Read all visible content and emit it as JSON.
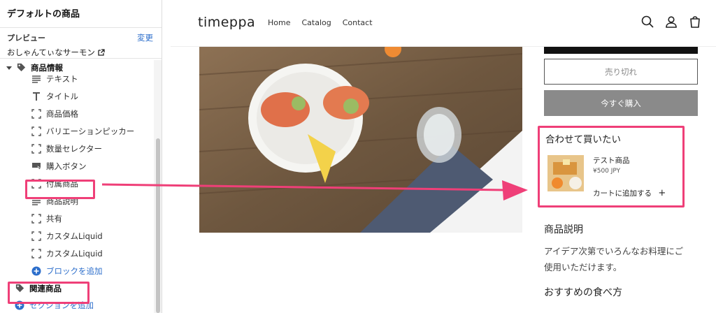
{
  "editor": {
    "section_title": "デフォルトの商品",
    "preview_label": "プレビュー",
    "preview_value": "おしゃんてぃなサーモン",
    "change_link": "変更",
    "group_label": "商品情報",
    "blocks": [
      {
        "label": "テキスト",
        "icon": "text-icon"
      },
      {
        "label": "タイトル",
        "icon": "title-icon"
      },
      {
        "label": "商品価格",
        "icon": "block-icon"
      },
      {
        "label": "バリエーションピッカー",
        "icon": "block-icon"
      },
      {
        "label": "数量セレクター",
        "icon": "block-icon"
      },
      {
        "label": "購入ボタン",
        "icon": "buy-button-icon"
      },
      {
        "label": "付属商品",
        "icon": "block-icon"
      },
      {
        "label": "商品説明",
        "icon": "text-icon"
      },
      {
        "label": "共有",
        "icon": "block-icon"
      },
      {
        "label": "カスタムLiquid",
        "icon": "block-icon"
      },
      {
        "label": "カスタムLiquid",
        "icon": "block-icon"
      }
    ],
    "add_block": "ブロックを追加",
    "related_products": "関連商品",
    "add_section": "セクションを追加"
  },
  "store": {
    "logo": "timeppa",
    "nav": [
      "Home",
      "Catalog",
      "Contact"
    ],
    "sold_out_button": "売り切れ",
    "buy_now_button": "今すぐ購入",
    "complementary": {
      "title": "合わせて買いたい",
      "product_name": "テスト商品",
      "product_price": "¥500 JPY",
      "add_to_cart": "カートに追加する"
    },
    "description_title": "商品説明",
    "description_line1": "アイデア次第でいろんなお料理にご",
    "description_line2": "使用いただけます。",
    "recommend_title": "おすすめの食べ方"
  },
  "colors": {
    "highlight": "#ef3f78",
    "link": "#2c6ecb",
    "buy_button": "#8a8a8a"
  }
}
